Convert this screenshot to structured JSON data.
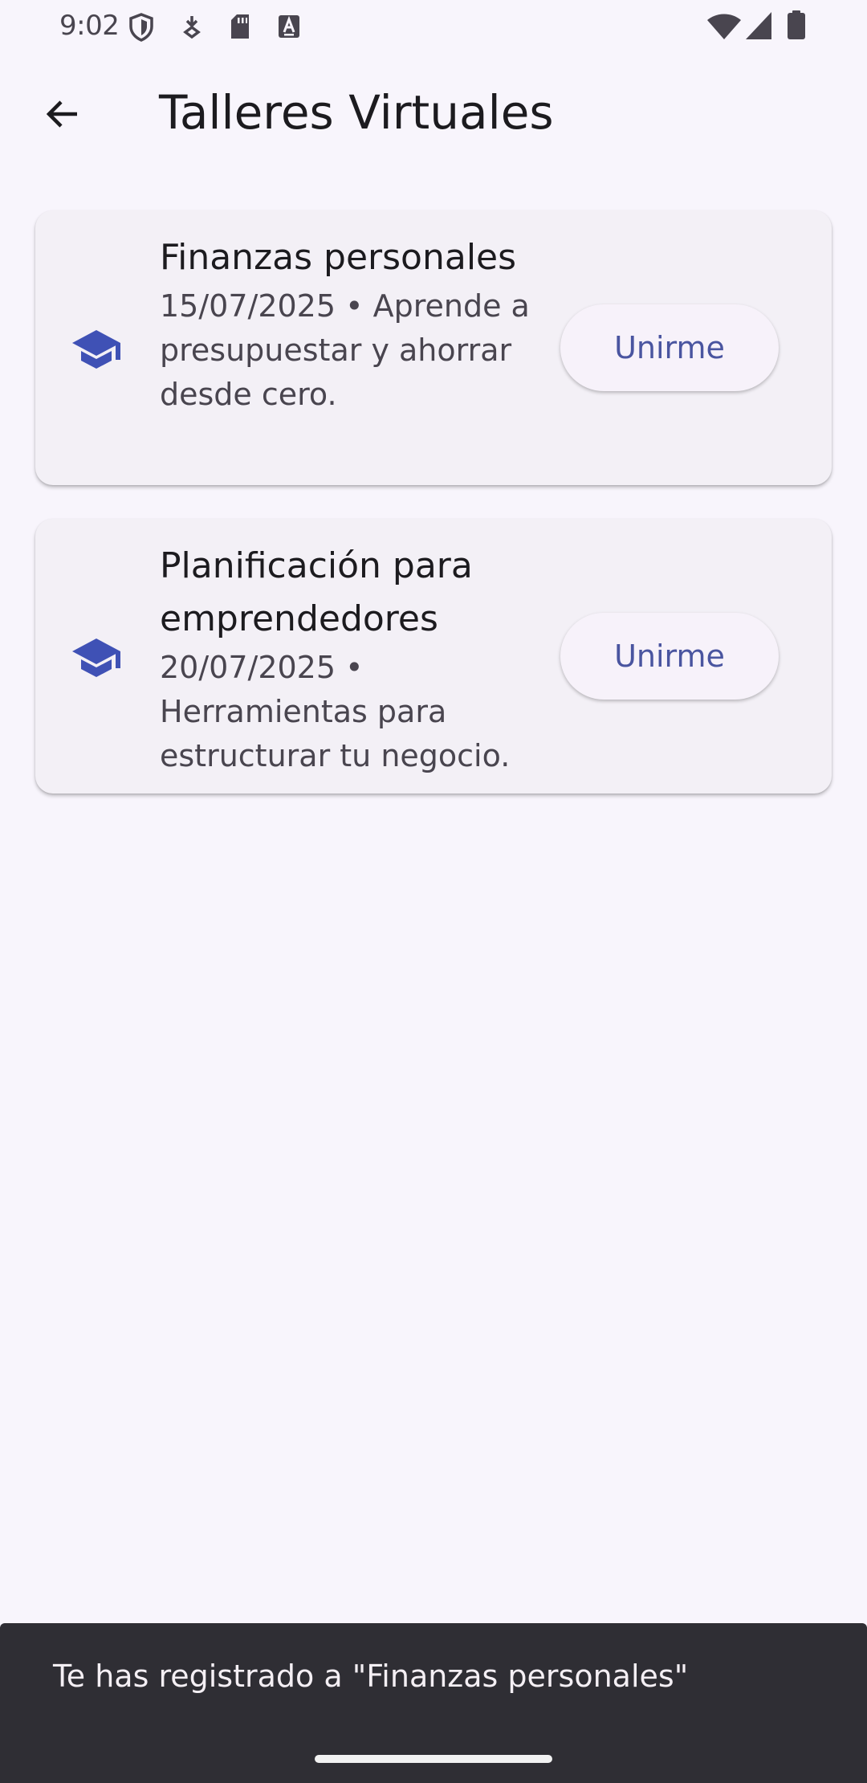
{
  "status_bar": {
    "time": "9:02",
    "icons_left": [
      "shield-icon",
      "download-icon",
      "sd-card-icon",
      "font-a-icon"
    ],
    "icons_right": [
      "wifi-icon",
      "cell-signal-icon",
      "battery-icon"
    ]
  },
  "app_bar": {
    "title": "Talleres Virtuales",
    "back_icon": "arrow-back-icon"
  },
  "workshops": [
    {
      "icon": "school-icon",
      "title": "Finanzas personales",
      "subtitle": "15/07/2025 • Aprende a presupuestar y ahorrar desde cero.",
      "button_label": "Unirme"
    },
    {
      "icon": "school-icon",
      "title": "Planificación para emprendedores",
      "subtitle": "20/07/2025 • Herramientas para estructurar tu negocio.",
      "button_label": "Unirme"
    }
  ],
  "snackbar": {
    "message": "Te has registrado a \"Finanzas personales\""
  },
  "colors": {
    "background": "#f8f5fc",
    "card": "#f3f0f6",
    "accent": "#3f51b5",
    "button_text": "#4a55a0",
    "snackbar": "#2f2e34"
  }
}
